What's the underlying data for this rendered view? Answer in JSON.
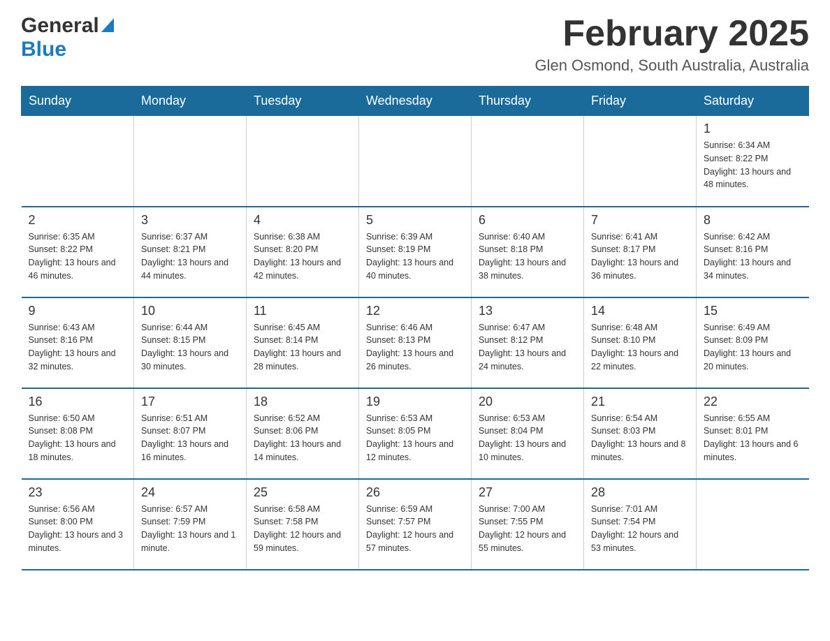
{
  "header": {
    "logo_general": "General",
    "logo_blue": "Blue",
    "title": "February 2025",
    "subtitle": "Glen Osmond, South Australia, Australia"
  },
  "days_of_week": [
    "Sunday",
    "Monday",
    "Tuesday",
    "Wednesday",
    "Thursday",
    "Friday",
    "Saturday"
  ],
  "weeks": [
    {
      "days": [
        {
          "number": "",
          "info": ""
        },
        {
          "number": "",
          "info": ""
        },
        {
          "number": "",
          "info": ""
        },
        {
          "number": "",
          "info": ""
        },
        {
          "number": "",
          "info": ""
        },
        {
          "number": "",
          "info": ""
        },
        {
          "number": "1",
          "info": "Sunrise: 6:34 AM\nSunset: 8:22 PM\nDaylight: 13 hours and 48 minutes."
        }
      ]
    },
    {
      "days": [
        {
          "number": "2",
          "info": "Sunrise: 6:35 AM\nSunset: 8:22 PM\nDaylight: 13 hours and 46 minutes."
        },
        {
          "number": "3",
          "info": "Sunrise: 6:37 AM\nSunset: 8:21 PM\nDaylight: 13 hours and 44 minutes."
        },
        {
          "number": "4",
          "info": "Sunrise: 6:38 AM\nSunset: 8:20 PM\nDaylight: 13 hours and 42 minutes."
        },
        {
          "number": "5",
          "info": "Sunrise: 6:39 AM\nSunset: 8:19 PM\nDaylight: 13 hours and 40 minutes."
        },
        {
          "number": "6",
          "info": "Sunrise: 6:40 AM\nSunset: 8:18 PM\nDaylight: 13 hours and 38 minutes."
        },
        {
          "number": "7",
          "info": "Sunrise: 6:41 AM\nSunset: 8:17 PM\nDaylight: 13 hours and 36 minutes."
        },
        {
          "number": "8",
          "info": "Sunrise: 6:42 AM\nSunset: 8:16 PM\nDaylight: 13 hours and 34 minutes."
        }
      ]
    },
    {
      "days": [
        {
          "number": "9",
          "info": "Sunrise: 6:43 AM\nSunset: 8:16 PM\nDaylight: 13 hours and 32 minutes."
        },
        {
          "number": "10",
          "info": "Sunrise: 6:44 AM\nSunset: 8:15 PM\nDaylight: 13 hours and 30 minutes."
        },
        {
          "number": "11",
          "info": "Sunrise: 6:45 AM\nSunset: 8:14 PM\nDaylight: 13 hours and 28 minutes."
        },
        {
          "number": "12",
          "info": "Sunrise: 6:46 AM\nSunset: 8:13 PM\nDaylight: 13 hours and 26 minutes."
        },
        {
          "number": "13",
          "info": "Sunrise: 6:47 AM\nSunset: 8:12 PM\nDaylight: 13 hours and 24 minutes."
        },
        {
          "number": "14",
          "info": "Sunrise: 6:48 AM\nSunset: 8:10 PM\nDaylight: 13 hours and 22 minutes."
        },
        {
          "number": "15",
          "info": "Sunrise: 6:49 AM\nSunset: 8:09 PM\nDaylight: 13 hours and 20 minutes."
        }
      ]
    },
    {
      "days": [
        {
          "number": "16",
          "info": "Sunrise: 6:50 AM\nSunset: 8:08 PM\nDaylight: 13 hours and 18 minutes."
        },
        {
          "number": "17",
          "info": "Sunrise: 6:51 AM\nSunset: 8:07 PM\nDaylight: 13 hours and 16 minutes."
        },
        {
          "number": "18",
          "info": "Sunrise: 6:52 AM\nSunset: 8:06 PM\nDaylight: 13 hours and 14 minutes."
        },
        {
          "number": "19",
          "info": "Sunrise: 6:53 AM\nSunset: 8:05 PM\nDaylight: 13 hours and 12 minutes."
        },
        {
          "number": "20",
          "info": "Sunrise: 6:53 AM\nSunset: 8:04 PM\nDaylight: 13 hours and 10 minutes."
        },
        {
          "number": "21",
          "info": "Sunrise: 6:54 AM\nSunset: 8:03 PM\nDaylight: 13 hours and 8 minutes."
        },
        {
          "number": "22",
          "info": "Sunrise: 6:55 AM\nSunset: 8:01 PM\nDaylight: 13 hours and 6 minutes."
        }
      ]
    },
    {
      "days": [
        {
          "number": "23",
          "info": "Sunrise: 6:56 AM\nSunset: 8:00 PM\nDaylight: 13 hours and 3 minutes."
        },
        {
          "number": "24",
          "info": "Sunrise: 6:57 AM\nSunset: 7:59 PM\nDaylight: 13 hours and 1 minute."
        },
        {
          "number": "25",
          "info": "Sunrise: 6:58 AM\nSunset: 7:58 PM\nDaylight: 12 hours and 59 minutes."
        },
        {
          "number": "26",
          "info": "Sunrise: 6:59 AM\nSunset: 7:57 PM\nDaylight: 12 hours and 57 minutes."
        },
        {
          "number": "27",
          "info": "Sunrise: 7:00 AM\nSunset: 7:55 PM\nDaylight: 12 hours and 55 minutes."
        },
        {
          "number": "28",
          "info": "Sunrise: 7:01 AM\nSunset: 7:54 PM\nDaylight: 12 hours and 53 minutes."
        },
        {
          "number": "",
          "info": ""
        }
      ]
    }
  ]
}
